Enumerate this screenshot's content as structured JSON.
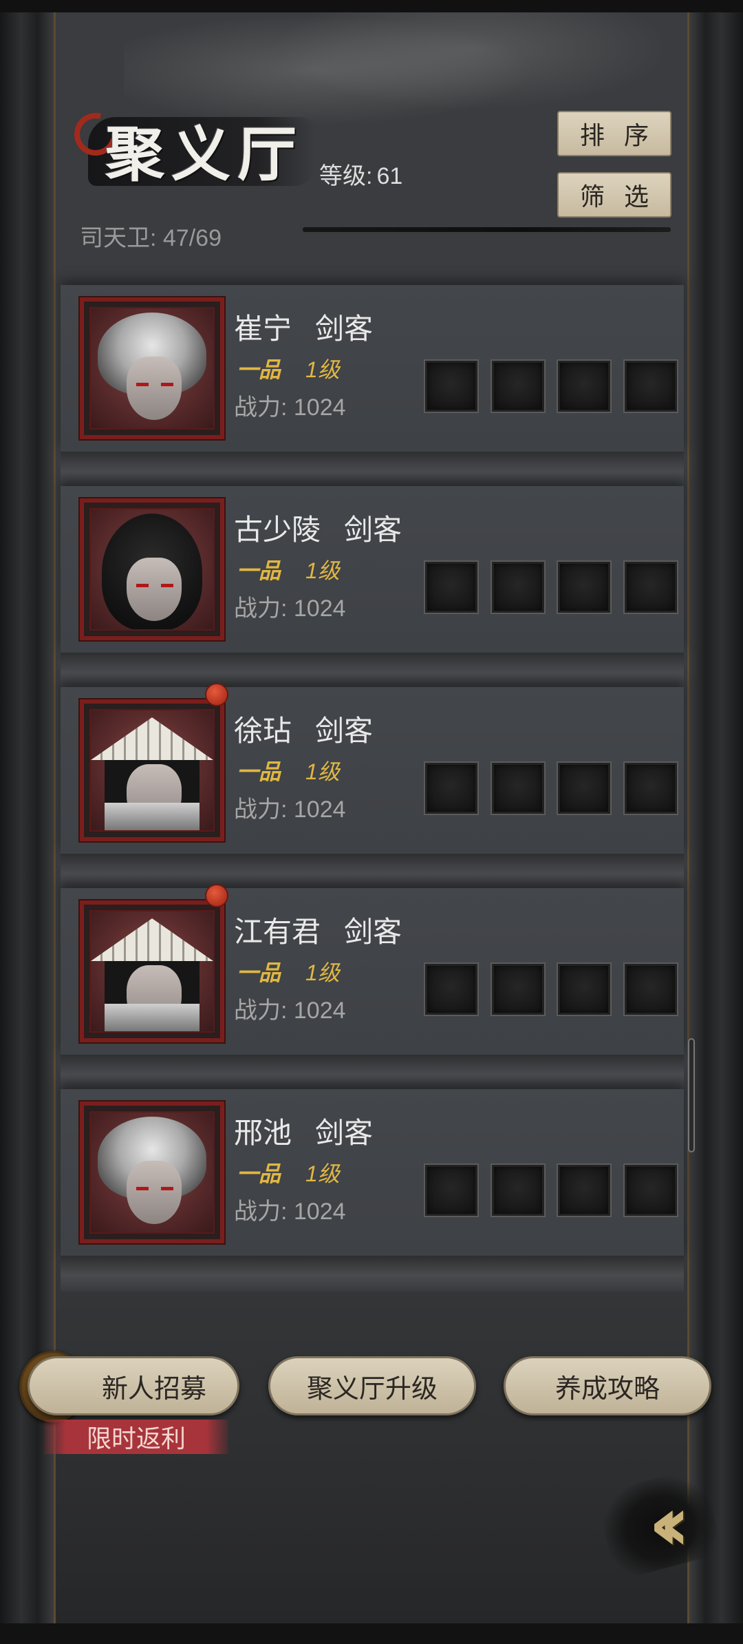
{
  "header": {
    "title": "聚义厅",
    "level_label": "等级:",
    "level_value": "61",
    "guard_count": "司天卫: 47/69",
    "sort_button": "排序",
    "filter_button": "筛选"
  },
  "heroes": [
    {
      "name": "崔宁",
      "class": "剑客",
      "rank": "一品",
      "level": "1级",
      "power": "战力:  1024",
      "portrait": "white-haired-swordsman",
      "notify": false
    },
    {
      "name": "古少陵",
      "class": "剑客",
      "rank": "一品",
      "level": "1级",
      "power": "战力:  1024",
      "portrait": "black-haired-swordsman",
      "notify": false
    },
    {
      "name": "徐玷",
      "class": "剑客",
      "rank": "一品",
      "level": "1级",
      "power": "战力:  1024",
      "portrait": "straw-hat-swordsman",
      "notify": true
    },
    {
      "name": "江有君",
      "class": "剑客",
      "rank": "一品",
      "level": "1级",
      "power": "战力:  1024",
      "portrait": "straw-hat-swordsman",
      "notify": true
    },
    {
      "name": "邢池",
      "class": "剑客",
      "rank": "一品",
      "level": "1级",
      "power": "战力:  1024",
      "portrait": "white-haired-swordsman",
      "notify": false
    }
  ],
  "actions": {
    "recruit": "新人招募",
    "upgrade": "聚义厅升级",
    "guide": "养成攻略",
    "promo_ribbon": "限时返利"
  },
  "icons": {
    "back": "double-chevron-left-icon",
    "recruit_emblem": "recruit-card-emblem-icon",
    "notify": "red-dot-notification-icon"
  },
  "colors": {
    "accent_gold": "#e1b743",
    "button_beige": "#d6cbb3",
    "portrait_frame_red": "#7a1e1c",
    "notify_red": "#c23a23",
    "ribbon_red": "#a8343b"
  }
}
